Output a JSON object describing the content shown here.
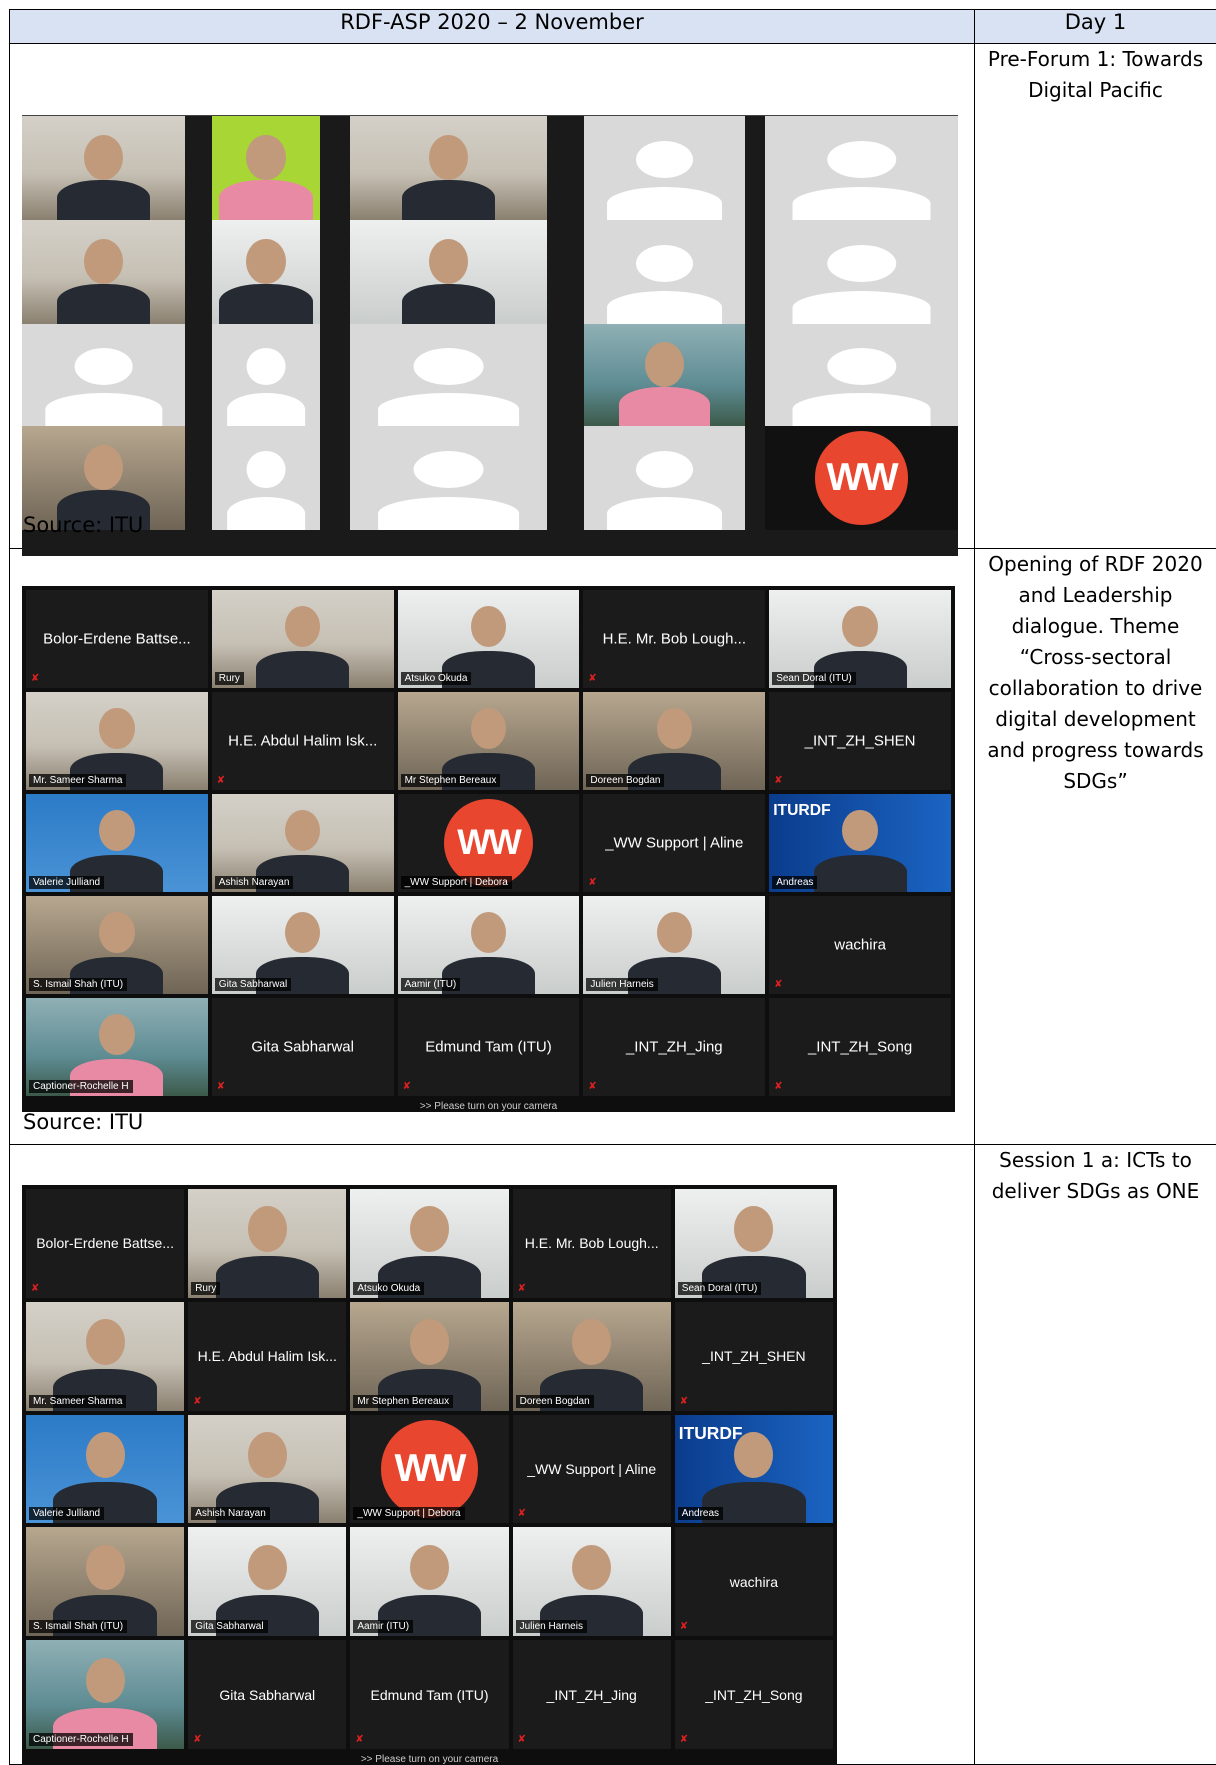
{
  "header": {
    "left": "RDF-ASP 2020 – 2 November",
    "right": "Day 1"
  },
  "rows": [
    {
      "label": "Pre-Forum 1: Towards Digital Pacific",
      "source": "Source: ITU",
      "ww_logo": "WW"
    },
    {
      "label": "Opening of RDF 2020 and Leadership dialogue. Theme “Cross-sectoral collaboration to drive digital development and progress towards SDGs”",
      "source": "Source: ITU",
      "footer_hint": ">> Please turn on your camera",
      "tiles": [
        {
          "type": "name",
          "name": "Bolor-Erdene Battse..."
        },
        {
          "type": "video",
          "label": "Rury",
          "bg": "p-room"
        },
        {
          "type": "video",
          "label": "Atsuko Okuda",
          "bg": "p-white",
          "active": true
        },
        {
          "type": "name",
          "name": "H.E. Mr. Bob Lough..."
        },
        {
          "type": "video",
          "label": "Sean Doral (ITU)",
          "bg": "p-white"
        },
        {
          "type": "video",
          "label": "Mr. Sameer Sharma",
          "bg": "p-room"
        },
        {
          "type": "name",
          "name": "H.E. Abdul Halim Isk..."
        },
        {
          "type": "video",
          "label": "Mr Stephen Bereaux",
          "bg": "p-office"
        },
        {
          "type": "video",
          "label": "Doreen Bogdan",
          "bg": "p-office"
        },
        {
          "type": "name",
          "name": "_INT_ZH_SHEN"
        },
        {
          "type": "video",
          "label": "Valerie Julliand",
          "bg": "p-blue"
        },
        {
          "type": "video",
          "label": "Ashish Narayan",
          "bg": "p-room"
        },
        {
          "type": "ww",
          "label": "_WW Support | Debora"
        },
        {
          "type": "name",
          "name": "_WW Support | Aline"
        },
        {
          "type": "itu",
          "label": "Andreas",
          "text": "ITURDF"
        },
        {
          "type": "video",
          "label": "S. Ismail Shah (ITU)",
          "bg": "p-office"
        },
        {
          "type": "video",
          "label": "Gita Sabharwal",
          "bg": "p-white"
        },
        {
          "type": "video",
          "label": "Aamir (ITU)",
          "bg": "p-white"
        },
        {
          "type": "video",
          "label": "Julien Harneis",
          "bg": "p-white"
        },
        {
          "type": "name",
          "name": "wachira"
        },
        {
          "type": "lake",
          "label": "Captioner-Rochelle H"
        },
        {
          "type": "name",
          "name": "Gita Sabharwal"
        },
        {
          "type": "name",
          "name": "Edmund Tam (ITU)"
        },
        {
          "type": "name",
          "name": "_INT_ZH_Jing"
        },
        {
          "type": "name",
          "name": "_INT_ZH_Song"
        }
      ]
    },
    {
      "label": "Session 1 a: ICTs to deliver SDGs as ONE"
    }
  ],
  "colors": {
    "header_bg": "#d9e2f3",
    "zoom_bg": "#1b1b1b",
    "ww_orange": "#e8462e",
    "active_border": "#d7e84b"
  }
}
